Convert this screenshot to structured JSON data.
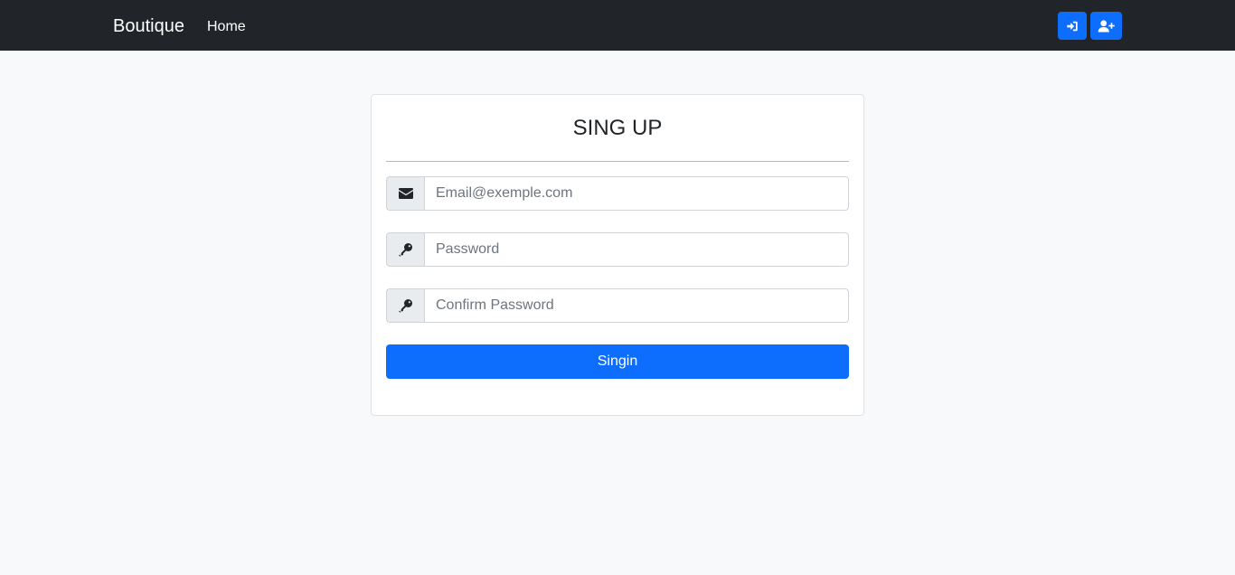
{
  "navbar": {
    "brand": "Boutique",
    "links": [
      {
        "label": "Home"
      }
    ],
    "actions": [
      {
        "icon": "login-icon"
      },
      {
        "icon": "user-plus-icon"
      }
    ]
  },
  "form": {
    "title": "SING UP",
    "fields": [
      {
        "icon": "envelope-icon",
        "placeholder": "Email@exemple.com",
        "value": ""
      },
      {
        "icon": "key-icon",
        "placeholder": "Password",
        "value": ""
      },
      {
        "icon": "key-icon",
        "placeholder": "Confirm Password",
        "value": ""
      }
    ],
    "submit_label": "Singin"
  },
  "colors": {
    "navbar_bg": "#212529",
    "primary": "#0d6efd",
    "page_bg": "#f8f9fa"
  }
}
